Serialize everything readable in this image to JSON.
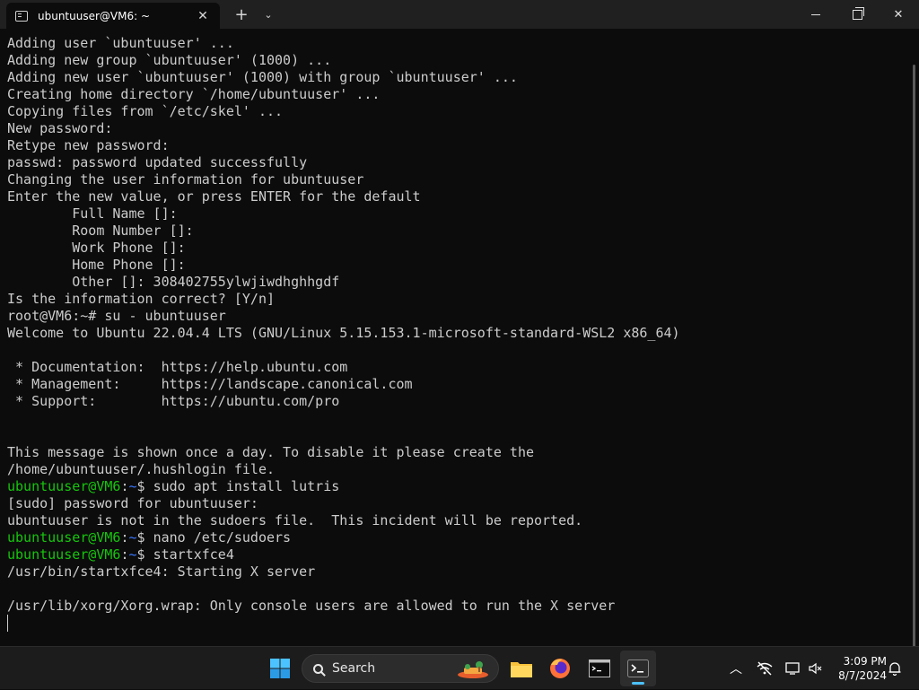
{
  "window": {
    "tab_title": "ubuntuuser@VM6: ~",
    "tab_close": "✕",
    "new_tab": "+",
    "tab_dropdown": "⌄",
    "close_glyph": "✕"
  },
  "terminal": {
    "lines": [
      "Adding user `ubuntuuser' ...",
      "Adding new group `ubuntuuser' (1000) ...",
      "Adding new user `ubuntuuser' (1000) with group `ubuntuuser' ...",
      "Creating home directory `/home/ubuntuuser' ...",
      "Copying files from `/etc/skel' ...",
      "New password:",
      "Retype new password:",
      "passwd: password updated successfully",
      "Changing the user information for ubuntuuser",
      "Enter the new value, or press ENTER for the default",
      "        Full Name []:",
      "        Room Number []:",
      "        Work Phone []:",
      "        Home Phone []:",
      "        Other []: 308402755ylwjiwdhghhgdf",
      "Is the information correct? [Y/n]",
      "root@VM6:~# su - ubuntuuser",
      "Welcome to Ubuntu 22.04.4 LTS (GNU/Linux 5.15.153.1-microsoft-standard-WSL2 x86_64)",
      "",
      " * Documentation:  https://help.ubuntu.com",
      " * Management:     https://landscape.canonical.com",
      " * Support:        https://ubuntu.com/pro",
      "",
      "",
      "This message is shown once a day. To disable it please create the",
      "/home/ubuntuuser/.hushlogin file."
    ],
    "prompt_user": "ubuntuuser@VM6",
    "prompt_colon": ":",
    "prompt_path": "~",
    "prompt_dollar": "$ ",
    "commands": [
      {
        "command": "sudo apt install lutris",
        "output": [
          "[sudo] password for ubuntuuser:",
          "ubuntuuser is not in the sudoers file.  This incident will be reported."
        ]
      },
      {
        "command": "nano /etc/sudoers",
        "output": []
      },
      {
        "command": "startxfce4",
        "output": [
          "/usr/bin/startxfce4: Starting X server",
          "",
          "/usr/lib/xorg/Xorg.wrap: Only console users are allowed to run the X server"
        ]
      }
    ]
  },
  "taskbar": {
    "search_label": "Search",
    "clock_time": "3:09 PM",
    "clock_date": "8/7/2024",
    "tray_chevron": "︿",
    "apps": [
      "start-icon",
      "file-explorer-icon",
      "firefox-icon",
      "command-prompt-icon",
      "windows-terminal-icon"
    ]
  },
  "colors": {
    "terminal_bg": "#0c0c0c",
    "terminal_fg": "#cccccc",
    "prompt_user": "#16c60c",
    "prompt_path": "#3b78ff",
    "taskbar_bg": "#1c1c1c",
    "accent": "#4cc2ff"
  }
}
